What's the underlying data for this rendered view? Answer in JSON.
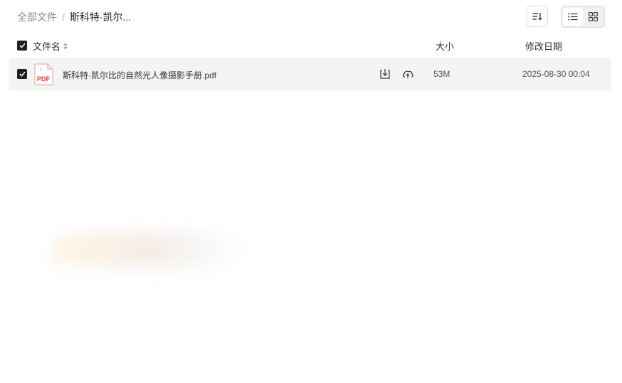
{
  "breadcrumb": {
    "root": "全部文件",
    "separator": "/",
    "current": "斯科特·凯尔..."
  },
  "toolbar": {
    "sort_icon": "sort-descending-icon",
    "view_modes": [
      "list-view-icon",
      "grid-view-icon"
    ],
    "active_view": "grid"
  },
  "table": {
    "header": {
      "name": "文件名",
      "size": "大小",
      "date": "修改日期"
    },
    "rows": [
      {
        "checked": true,
        "type_badge": "PDF",
        "name": "斯科特·凯尔比的自然光人像摄影手册.pdf",
        "size": "53M",
        "date": "2025-08-30 00:04"
      }
    ]
  },
  "colors": {
    "row_bg": "#f4f4f4",
    "pdf_red": "#e5393c",
    "checkbox": "#1f1f1f"
  }
}
